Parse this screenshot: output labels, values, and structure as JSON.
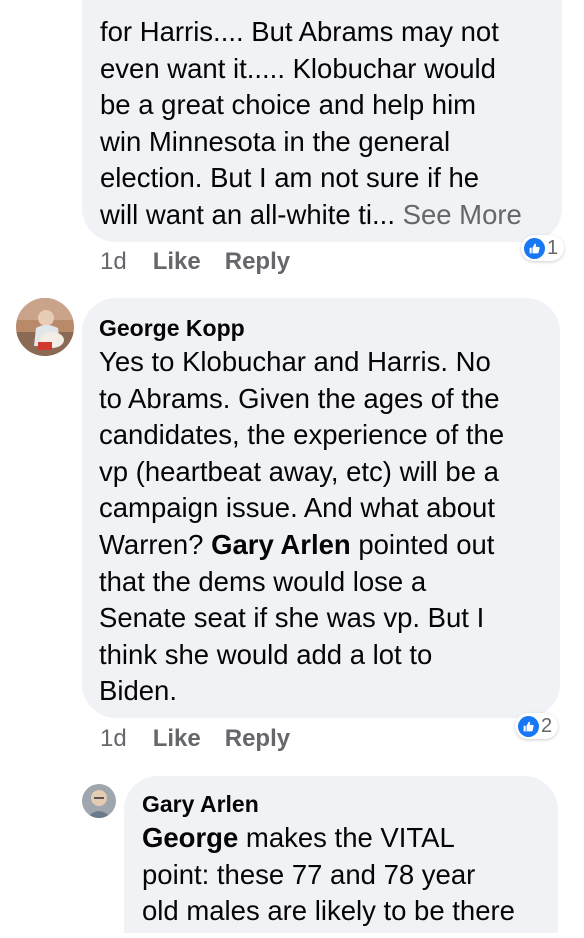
{
  "comment1": {
    "lines_text": "for Harris.... But Abrams may not\neven want it..... Klobuchar would\nbe a great choice and help him\nwin Minnesota in the general\nelection. But I am not sure if he\nwill want an all-white ti...",
    "see_more": "See More",
    "time": "1d",
    "like": "Like",
    "reply": "Reply",
    "reaction_count": "1",
    "reaction_icon": "thumbs-up-icon"
  },
  "comment2": {
    "author": "George Kopp",
    "text_before": "Yes to Klobuchar and Harris. No\nto Abrams. Given the ages of the\ncandidates, the experience of the\nvp (heartbeat away, etc) will be a\ncampaign issue. And what about\nWarren? ",
    "mention": "Gary Arlen",
    "text_after": " pointed out\nthat the dems would lose a\nSenate seat if she was vp. But I\nthink she would add a lot to\nBiden.",
    "time": "1d",
    "like": "Like",
    "reply": "Reply",
    "reaction_count": "2",
    "reaction_icon": "thumbs-up-icon"
  },
  "comment3": {
    "author": "Gary Arlen",
    "mention": "George",
    "text_after": " makes the VITAL\npoint: these 77 and 78 year\nold males are likely to be there"
  },
  "colors": {
    "bubble": "#f0f2f5",
    "like_blue": "#1877f2",
    "meta_gray": "#65676b"
  }
}
